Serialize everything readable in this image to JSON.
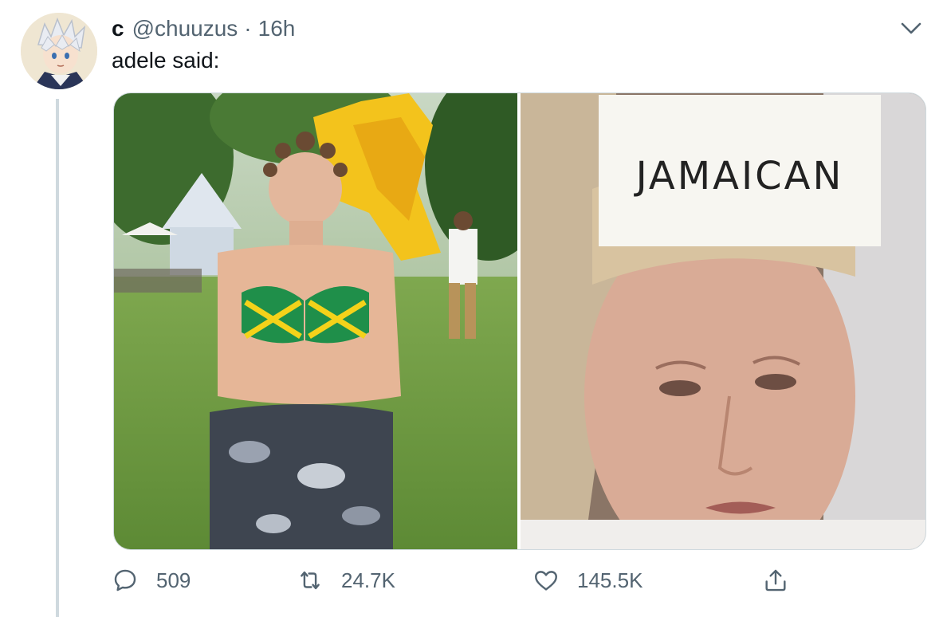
{
  "tweet": {
    "display_name": "c",
    "handle": "@chuuzus",
    "separator": "·",
    "time": "16h",
    "text": "adele said:",
    "media": {
      "left_photo": {
        "description_icon": "photo"
      },
      "right_photo": {
        "sign_text": "JAMAICAN"
      }
    },
    "actions": {
      "reply_count": "509",
      "retweet_count": "24.7K",
      "like_count": "145.5K"
    }
  },
  "colors": {
    "text": "#0f1419",
    "secondary": "#536471",
    "border": "#cfd9de"
  }
}
